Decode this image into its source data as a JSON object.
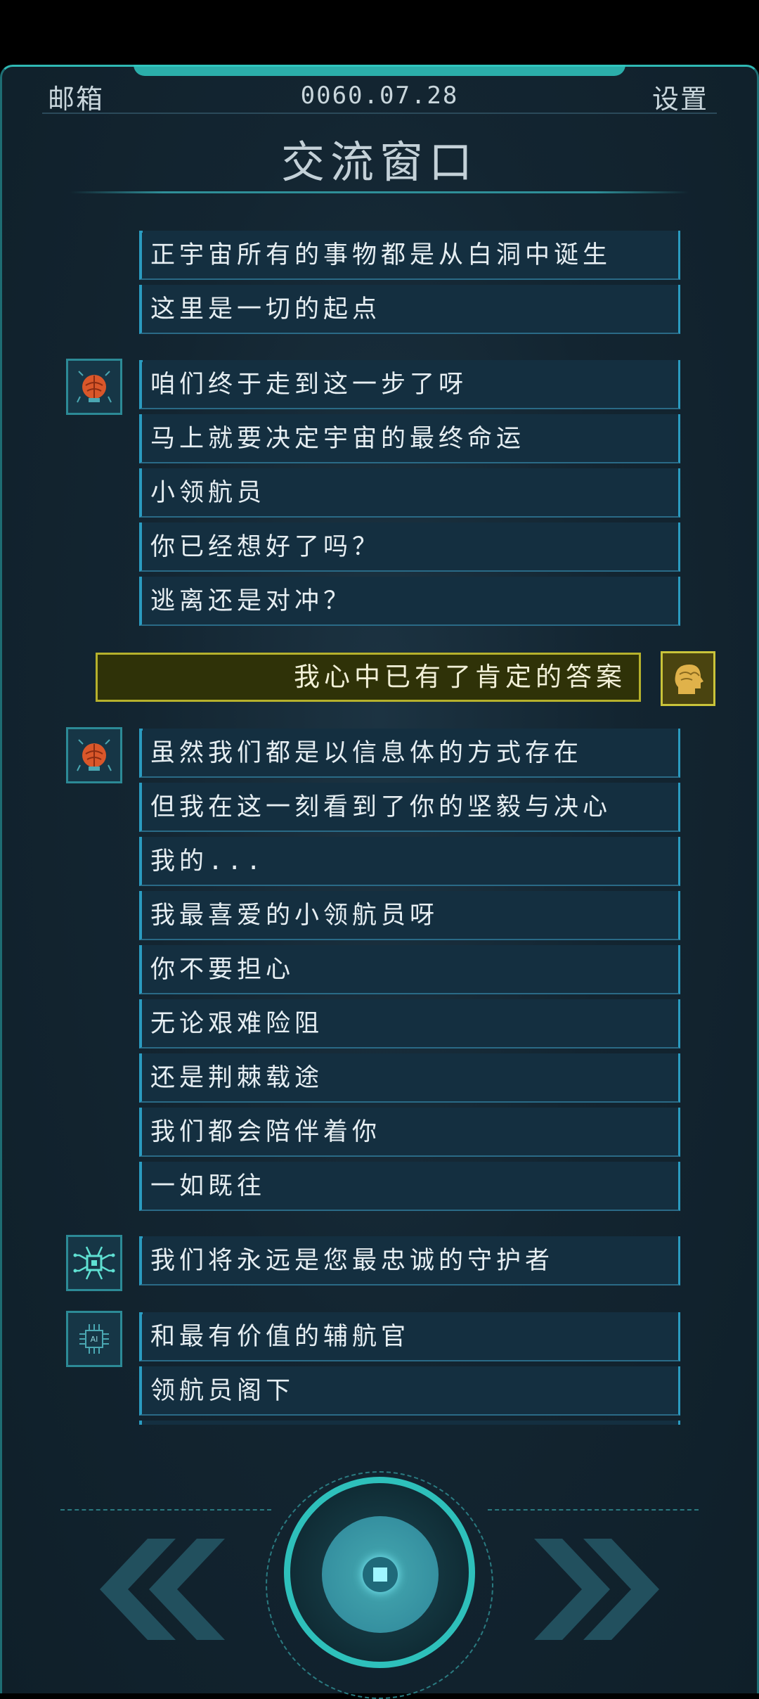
{
  "header": {
    "mailbox": "邮箱",
    "date": "0060.07.28",
    "settings": "设置"
  },
  "title": "交流窗口",
  "messages": [
    "正宇宙所有的事物都是从白洞中诞生",
    "这里是一切的起点",
    "咱们终于走到这一步了呀",
    "马上就要决定宇宙的最终命运",
    "小领航员",
    "你已经想好了吗？",
    "逃离还是对冲？",
    "我心中已有了肯定的答案",
    "虽然我们都是以信息体的方式存在",
    "但我在这一刻看到了你的坚毅与决心",
    "我的...",
    "我最喜爱的小领航员呀",
    "你不要担心",
    "无论艰难险阻",
    "还是荆棘载途",
    "我们都会陪伴着你",
    "一如既往",
    "我们将永远是您最忠诚的守护者",
    "和最有价值的辅航官",
    "领航员阁下"
  ],
  "avatars": {
    "brain": "brain-avatar-icon",
    "circuit": "circuit-avatar-icon",
    "ai_chip": "ai-chip-avatar-icon",
    "ai_chip_label": "AI",
    "user": "user-head-avatar-icon"
  },
  "colors": {
    "accent": "#2ec0bb",
    "bubble": "#142f40",
    "user_bubble": "#2f3208",
    "user_border": "#b6b12c"
  }
}
